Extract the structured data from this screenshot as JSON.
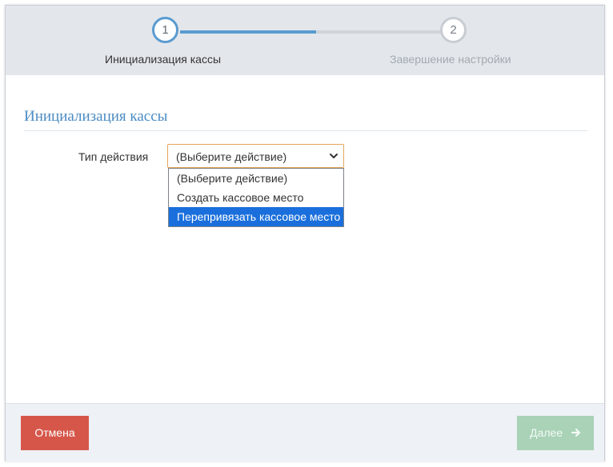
{
  "wizard": {
    "steps": [
      {
        "number": "1",
        "label": "Инициализация кассы",
        "state": "active"
      },
      {
        "number": "2",
        "label": "Завершение настройки",
        "state": "pending"
      }
    ],
    "progress_fraction": 0.5
  },
  "section": {
    "title": "Инициализация кассы"
  },
  "form": {
    "action_type": {
      "label": "Тип действия",
      "selected_value": "(Выберите действие)",
      "options": [
        {
          "label": "(Выберите действие)",
          "highlighted": false
        },
        {
          "label": "Создать кассовое место",
          "highlighted": false
        },
        {
          "label": "Перепривязать кассовое место",
          "highlighted": true
        }
      ],
      "dropdown_open": true
    }
  },
  "footer": {
    "cancel_label": "Отмена",
    "next_label": "Далее",
    "next_enabled": false
  },
  "colors": {
    "accent": "#5a9bd0",
    "cancel": "#d6574a",
    "next_disabled": "#a9d2b7",
    "selected_option": "#1a6fdc",
    "focus_border": "#e3a65a"
  },
  "icons": {
    "select_chevron": "chevron-down-icon",
    "next_arrow": "arrow-right-icon"
  }
}
